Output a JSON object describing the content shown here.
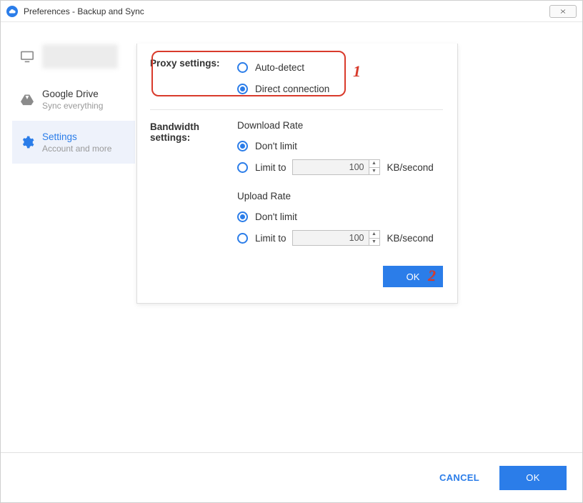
{
  "window": {
    "title": "Preferences - Backup and Sync"
  },
  "sidebar": {
    "items": [
      {
        "title": "",
        "sub": ""
      },
      {
        "title": "Google Drive",
        "sub": "Sync everything"
      },
      {
        "title": "Settings",
        "sub": "Account and more"
      }
    ]
  },
  "panel": {
    "proxy_label": "Proxy settings:",
    "proxy": {
      "auto_detect": "Auto-detect",
      "direct": "Direct connection"
    },
    "bandwidth_label": "Bandwidth settings:",
    "download": {
      "heading": "Download Rate",
      "dont_limit": "Don't limit",
      "limit_to": "Limit to",
      "value": "100",
      "unit": "KB/second"
    },
    "upload": {
      "heading": "Upload Rate",
      "dont_limit": "Don't limit",
      "limit_to": "Limit to",
      "value": "100",
      "unit": "KB/second"
    },
    "ok": "OK"
  },
  "footer": {
    "cancel": "CANCEL",
    "ok": "OK"
  },
  "annotations": {
    "one": "1",
    "two": "2"
  }
}
